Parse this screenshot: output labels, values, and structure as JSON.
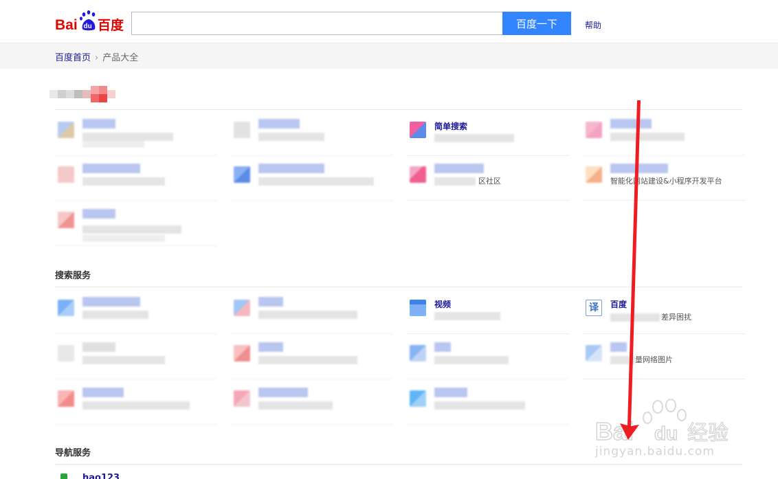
{
  "header": {
    "logo_text": "Baidu百度",
    "search_button": "百度一下",
    "search_value": "",
    "help": "帮助"
  },
  "breadcrumb": {
    "home": "百度首页",
    "current": "产品大全"
  },
  "sections": {
    "search": {
      "title": "搜索服务"
    },
    "nav": {
      "title": "导航服务"
    }
  },
  "visible_labels": {
    "simple_search": "简单搜索",
    "community_suffix": "区社区",
    "site_builder": "智能化网站建设&小程序开发平台",
    "video": "视频",
    "translate": "百度",
    "translate_desc": "差异困扰",
    "image_desc": "量网络图片",
    "hao123": "hao123"
  },
  "watermark": {
    "text": "jingyan.baidu.com",
    "brand": "Bai du 经验"
  },
  "colors": {
    "search_button": "#3385ff",
    "arrow": "#ee1d23",
    "link": "#1a1a9a"
  }
}
